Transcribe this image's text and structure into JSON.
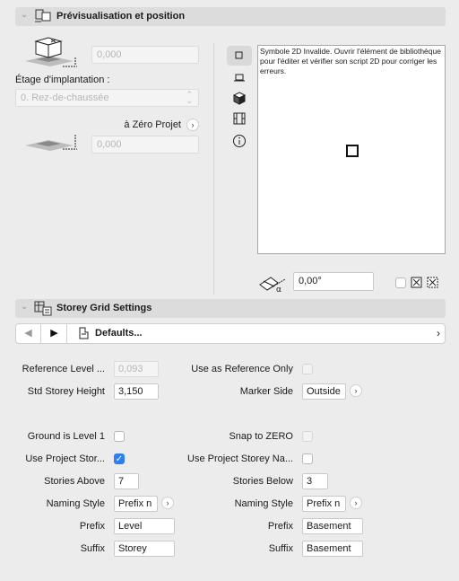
{
  "preview_section": {
    "title": "Prévisualisation et position",
    "offset_value": "0,000",
    "storey_label": "Étage d'implantation :",
    "storey_value": "0. Rez-de-chaussée",
    "zero_label": "à Zéro Projet",
    "zero_value": "0,000",
    "preview_message": "Symbole 2D Invalide. Ouvrir l'élément de bibliothèque pour l'éditer et vérifier son script 2D pour corriger les erreurs.",
    "angle_value": "0,00°"
  },
  "grid_section": {
    "title": "Storey Grid Settings",
    "preset_label": "Defaults...",
    "reference_level_label": "Reference Level ...",
    "reference_level_value": "0,093",
    "use_as_reference_label": "Use as Reference Only",
    "std_height_label": "Std Storey Height",
    "std_height_value": "3,150",
    "marker_side_label": "Marker Side",
    "marker_side_value": "Outside",
    "ground_level_label": "Ground is Level 1",
    "snap_zero_label": "Snap to ZERO",
    "use_project_stor_label": "Use Project Stor...",
    "use_project_na_label": "Use Project Storey Na...",
    "stories_above_label": "Stories Above",
    "stories_above_value": "7",
    "stories_below_label": "Stories Below",
    "stories_below_value": "3",
    "naming_style_label": "Naming Style",
    "naming_style_left": "Prefix n",
    "naming_style_right": "Prefix n",
    "prefix_label": "Prefix",
    "prefix_left": "Level",
    "prefix_right": "Basement",
    "suffix_label": "Suffix",
    "suffix_left": "Storey",
    "suffix_right": "Basement"
  }
}
